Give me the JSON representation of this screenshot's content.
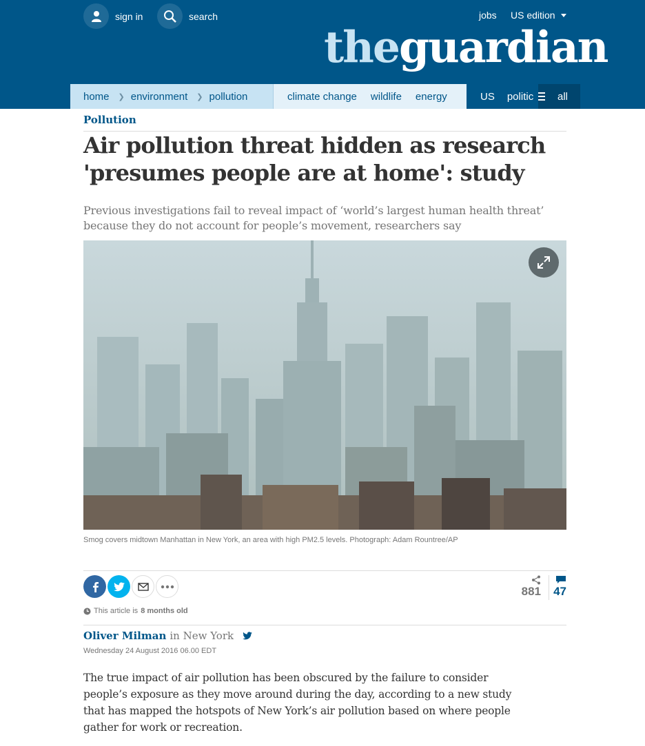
{
  "header": {
    "sign_in": "sign in",
    "search": "search",
    "jobs": "jobs",
    "edition": "US edition",
    "logo_the": "the",
    "logo_guardian": "guardian"
  },
  "nav": {
    "breadcrumbs": [
      "home",
      "environment",
      "pollution"
    ],
    "sub_items": [
      "climate change",
      "wildlife",
      "energy"
    ],
    "main_items": [
      "US",
      "politic"
    ],
    "all_label": "all"
  },
  "article": {
    "section": "Pollution",
    "headline": "Air pollution threat hidden as research 'presumes people are at home': study",
    "standfirst": "Previous investigations fail to reveal impact of ‘world’s largest human health threat’ because they do not account for people’s movement, researchers say",
    "caption": "Smog covers midtown Manhattan in New York, an area with high PM2.5 levels. Photograph: Adam Rountree/AP",
    "share_count": "881",
    "comment_count": "47",
    "age_prefix": "This article is",
    "age_value": "8 months old",
    "author": "Oliver Milman",
    "location": "in New York",
    "date": "Wednesday 24 August 2016 06.00 EDT",
    "first_paragraph": "The true impact of air pollution has been obscured by the failure to consider people’s exposure as they move around during the day, according to a new study that has mapped the hotspots of New York’s air pollution based on where people gather for work or recreation."
  },
  "colors": {
    "brand_blue": "#005689",
    "light_blue": "#c7e3f3",
    "facebook": "#3067a3",
    "twitter": "#03b3ee",
    "text": "#333333"
  }
}
